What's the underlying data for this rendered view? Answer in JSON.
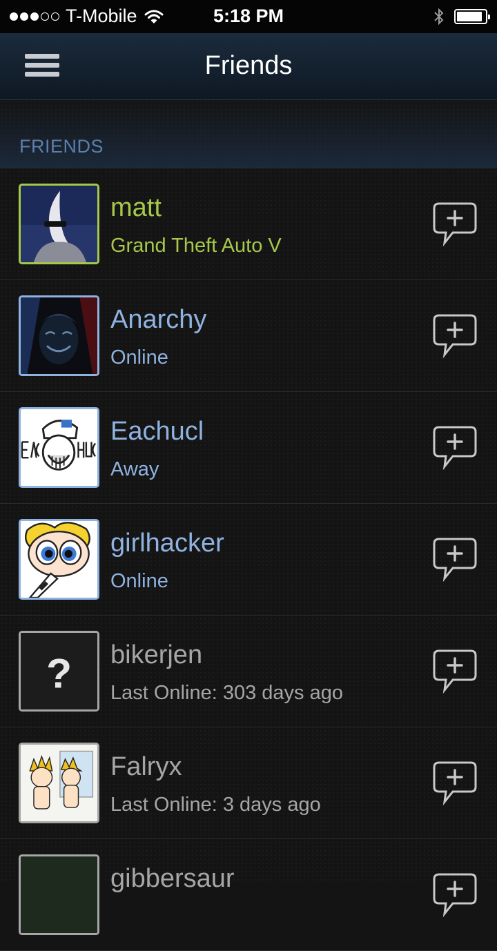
{
  "status_bar": {
    "carrier": "T-Mobile",
    "time": "5:18 PM",
    "battery_level": 0.9
  },
  "nav": {
    "title": "Friends",
    "menu_icon": "hamburger-menu-icon"
  },
  "section": {
    "label": "FRIENDS"
  },
  "colors": {
    "in_game": "#a7c84a",
    "online": "#8fb2e0",
    "offline": "#a6a6a6"
  },
  "friends": [
    {
      "name": "matt",
      "status": "Grand Theft Auto V",
      "state": "in_game"
    },
    {
      "name": "Anarchy",
      "status": "Online",
      "state": "online"
    },
    {
      "name": "Eachucl",
      "status": "Away",
      "state": "online"
    },
    {
      "name": "girlhacker",
      "status": "Online",
      "state": "online"
    },
    {
      "name": "bikerjen",
      "status": "Last Online: 303 days ago",
      "state": "offline"
    },
    {
      "name": "Falryx",
      "status": "Last Online: 3 days ago",
      "state": "offline"
    },
    {
      "name": "gibbersaur",
      "status": "",
      "state": "offline"
    }
  ]
}
